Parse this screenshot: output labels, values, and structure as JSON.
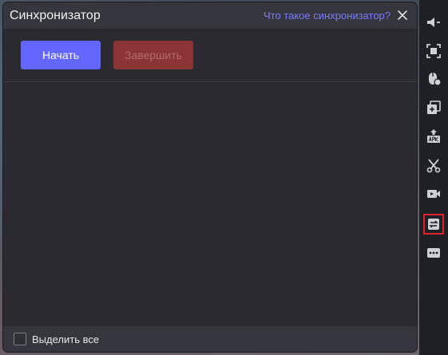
{
  "dialog": {
    "title": "Синхронизатор",
    "help_link": "Что такое синхронизатор?",
    "close_icon": "close-icon"
  },
  "toolbar": {
    "start_label": "Начать",
    "finish_label": "Завершить"
  },
  "footer": {
    "select_all_label": "Выделить все"
  },
  "sidebar": {
    "items": [
      {
        "icon": "volume-icon"
      },
      {
        "icon": "screenshot-icon"
      },
      {
        "icon": "mouse-icon"
      },
      {
        "icon": "multi-instance-icon"
      },
      {
        "icon": "apk-install-icon"
      },
      {
        "icon": "scissors-icon"
      },
      {
        "icon": "video-record-icon"
      },
      {
        "icon": "sync-icon"
      },
      {
        "icon": "more-icon"
      }
    ],
    "highlighted_item": "sync-icon"
  },
  "colors": {
    "accent": "#6367ff",
    "danger_disabled": "#8a3436",
    "link": "#7b7bff",
    "highlight": "#e0202a"
  }
}
